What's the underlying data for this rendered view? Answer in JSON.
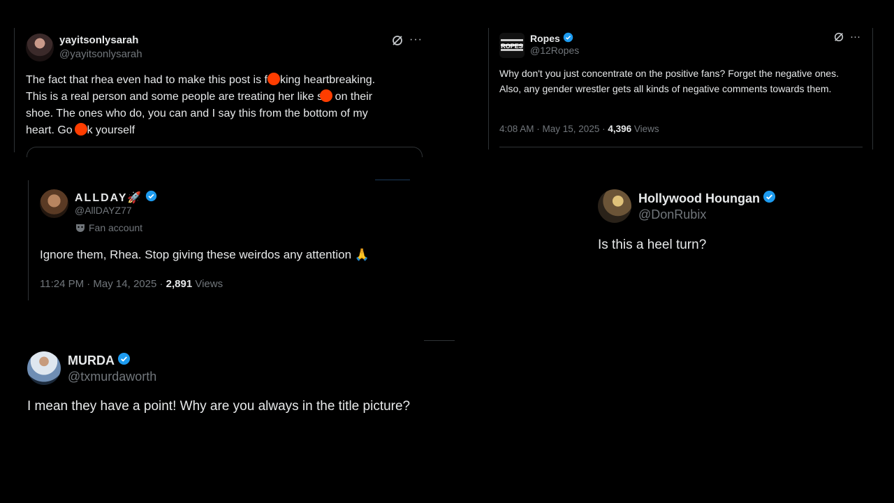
{
  "tweets": {
    "sarah": {
      "name": "yayitsonlysarah",
      "handle": "@yayitsonlysarah",
      "line1a": "The fact that rhea even had to make this post is f",
      "line1b": "king heartbreaking.",
      "line2a": "This is a real person and some people are treating her like sl",
      "line2b": "on their",
      "line3": "shoe. The ones who do, you can and I say this from the bottom of my",
      "line4a": "heart. Go f",
      "line4b": "k yourself"
    },
    "ropes": {
      "name": "Ropes",
      "handle": "@12Ropes",
      "text": "Why don't you just concentrate on the positive fans? Forget the negative ones. Also, any gender wrestler gets all kinds of negative  comments towards them.",
      "time": "4:08 AM · May 15, 2025 · ",
      "views_count": "4,396",
      "views_label": " Views"
    },
    "allday": {
      "name": "ALLDAY🚀",
      "handle": "@AllDAYZ77",
      "badge": "Fan account",
      "text": "Ignore them, Rhea. Stop giving these weirdos any attention 🙏",
      "time": "11:24 PM · May 14, 2025 · ",
      "views_count": "2,891",
      "views_label": " Views"
    },
    "hollywood": {
      "name": "Hollywood Houngan",
      "handle": "@DonRubix",
      "text": "Is this a heel turn?"
    },
    "murda": {
      "name": "MURDA",
      "handle": "@txmurdaworth",
      "text": "I mean they have a point! Why are you always in the title picture?"
    }
  },
  "icons": {
    "grok": "grok-icon",
    "more": "more-icon",
    "verified": "verified-badge-icon",
    "fan": "mask-icon"
  },
  "colors": {
    "background": "#000000",
    "text": "#e7e9ea",
    "muted": "#71767b",
    "verified": "#1d9bf0",
    "redaction": "#ff3d00"
  }
}
